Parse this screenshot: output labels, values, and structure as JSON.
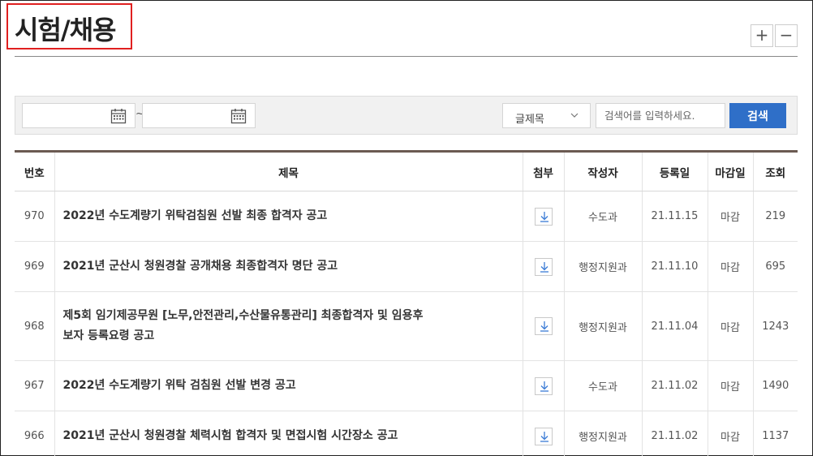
{
  "page": {
    "title": "시험/채용"
  },
  "zoom": {
    "plus": "+",
    "minus": "−"
  },
  "search": {
    "tilde": "~",
    "field_select": "글제목",
    "placeholder": "검색어를 입력하세요.",
    "button": "검색"
  },
  "table": {
    "headers": [
      "번호",
      "제목",
      "첨부",
      "작성자",
      "등록일",
      "마감일",
      "조회"
    ],
    "rows": [
      {
        "no": "970",
        "title": "2022년 수도계량기 위탁검침원 선발 최종 합격자 공고",
        "author": "수도과",
        "date": "21.11.15",
        "deadline": "마감",
        "views": "219"
      },
      {
        "no": "969",
        "title": "2021년 군산시 청원경찰 공개채용 최종합격자 명단 공고",
        "author": "행정지원과",
        "date": "21.11.10",
        "deadline": "마감",
        "views": "695"
      },
      {
        "no": "968",
        "title": "제5회 임기제공무원 [노무,안전관리,수산물유통관리] 최종합격자 및 임용후",
        "title2": "보자 등록요령 공고",
        "author": "행정지원과",
        "date": "21.11.04",
        "deadline": "마감",
        "views": "1243"
      },
      {
        "no": "967",
        "title": "2022년 수도계량기 위탁 검침원 선발 변경 공고",
        "author": "수도과",
        "date": "21.11.02",
        "deadline": "마감",
        "views": "1490"
      },
      {
        "no": "966",
        "title": "2021년 군산시 청원경찰 체력시험 합격자 및 면접시험 시간장소 공고",
        "author": "행정지원과",
        "date": "21.11.02",
        "deadline": "마감",
        "views": "1137"
      }
    ]
  },
  "icons": {
    "calendar": "calendar-icon",
    "download": "download-icon",
    "chevron": "chevron-down-icon"
  },
  "colors": {
    "title_highlight": "#e02020",
    "search_button": "#2f6fc8",
    "table_top_border": "#6b5a52",
    "download_arrow": "#3a7bd5"
  }
}
